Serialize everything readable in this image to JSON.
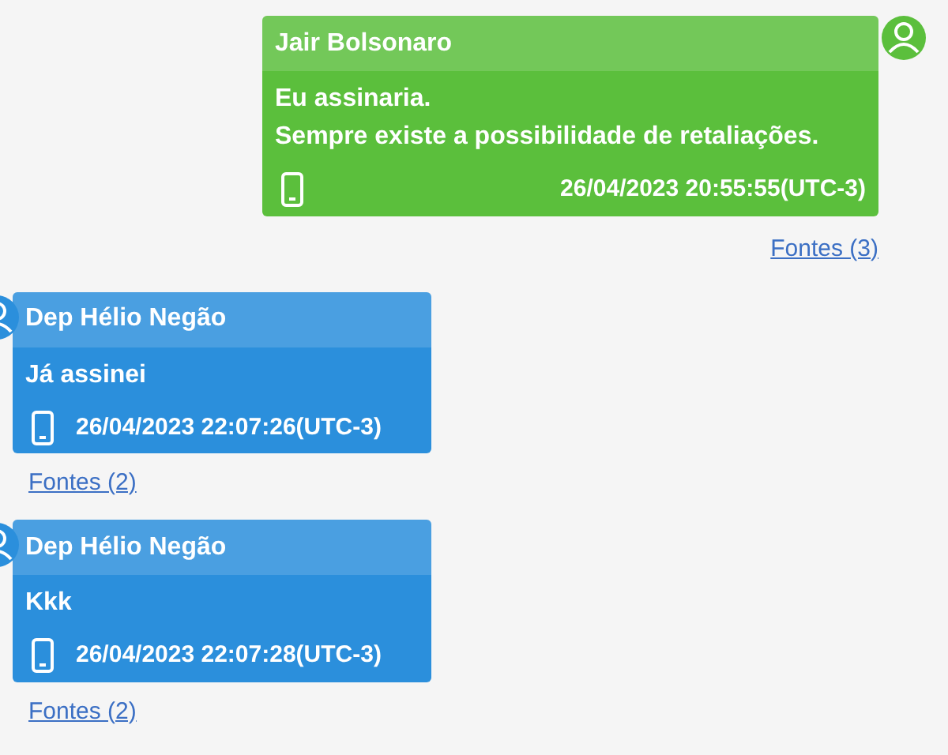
{
  "messages": [
    {
      "kind": "outgoing",
      "color": "#5bbf3c",
      "sender": "Jair Bolsonaro",
      "lines": [
        "Eu assinaria.",
        "Sempre existe a possibilidade de retaliações."
      ],
      "time": "26/04/2023 20:55:55(UTC-3)",
      "sources": "Fontes (3)"
    },
    {
      "kind": "incoming",
      "color": "#2b8fdc",
      "sender": "Dep Hélio Negão",
      "lines": [
        "Já assinei"
      ],
      "time": "26/04/2023 22:07:26(UTC-3)",
      "sources": "Fontes (2)"
    },
    {
      "kind": "incoming",
      "color": "#2b8fdc",
      "sender": "Dep Hélio Negão",
      "lines": [
        "Kkk"
      ],
      "time": "26/04/2023 22:07:28(UTC-3)",
      "sources": "Fontes (2)"
    }
  ]
}
